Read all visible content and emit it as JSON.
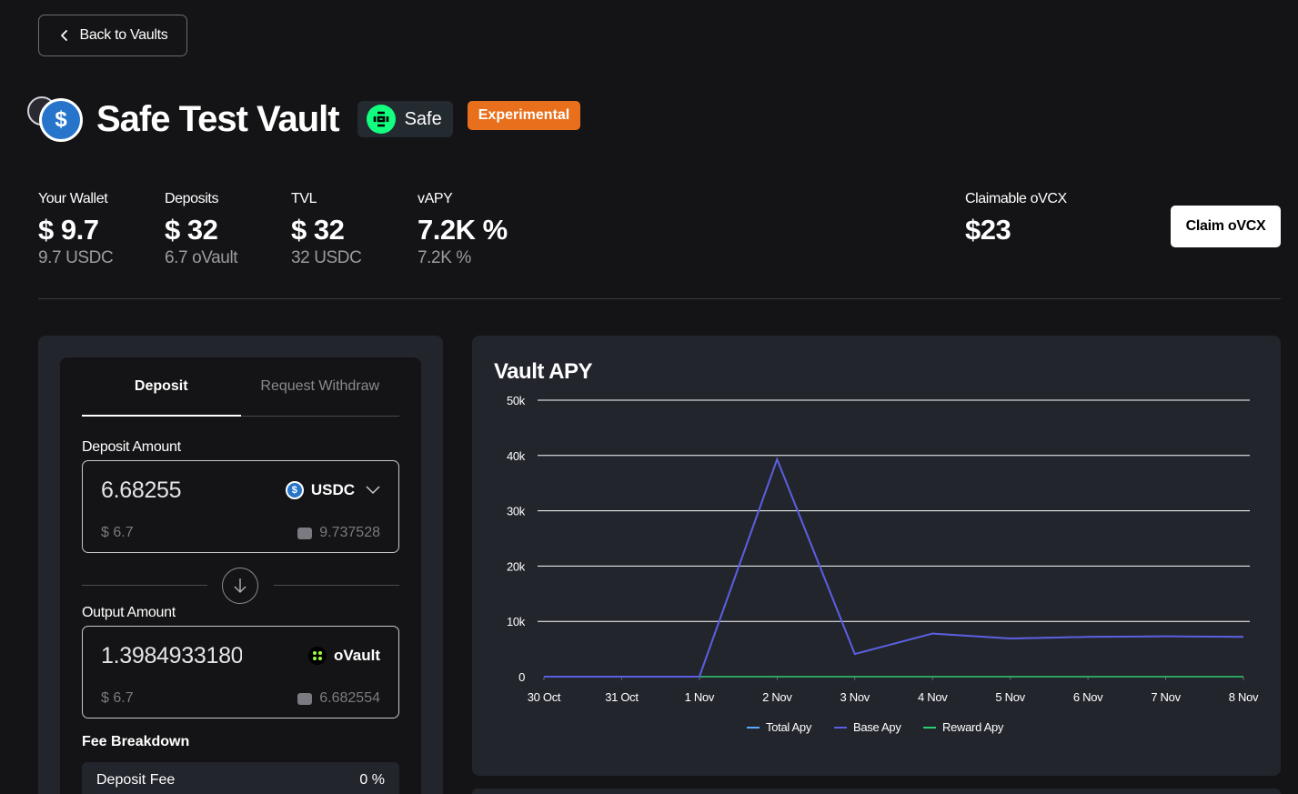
{
  "nav": {
    "back_label": "Back to Vaults"
  },
  "vault": {
    "title": "Safe Test Vault",
    "protocol": "Safe",
    "badge": "Experimental",
    "logo_symbol": "$"
  },
  "stats": [
    {
      "label": "Your Wallet",
      "value": "$ 9.7",
      "sub": "9.7 USDC"
    },
    {
      "label": "Deposits",
      "value": "$ 32",
      "sub": "6.7 oVault"
    },
    {
      "label": "TVL",
      "value": "$ 32",
      "sub": "32 USDC"
    },
    {
      "label": "vAPY",
      "value": "7.2K %",
      "sub": "7.2K %"
    }
  ],
  "claim": {
    "label": "Claimable oVCX",
    "value": "$23",
    "button": "Claim oVCX"
  },
  "form": {
    "tabs": [
      "Deposit",
      "Request Withdraw"
    ],
    "active_tab": "Deposit",
    "deposit": {
      "label": "Deposit Amount",
      "amount": "6.68255",
      "token": "USDC",
      "usd": "$ 6.7",
      "balance": "9.737528"
    },
    "output": {
      "label": "Output Amount",
      "amount": "1.39849331806",
      "token": "oVault",
      "usd": "$ 6.7",
      "balance": "6.682554"
    },
    "fee": {
      "label": "Fee Breakdown",
      "name": "Deposit Fee",
      "value": "0 %"
    }
  },
  "colors": {
    "background": "#141416",
    "panel": "#23252d",
    "accent_orange": "#e8701c",
    "safe_green": "#12ff80",
    "total_apy": "#5aa7ff",
    "base_apy": "#5a5ee0",
    "reward_apy": "#2ecc71"
  },
  "chart_data": {
    "type": "line",
    "title": "Vault APY",
    "categories": [
      "30 Oct",
      "31 Oct",
      "1 Nov",
      "2 Nov",
      "3 Nov",
      "4 Nov",
      "5 Nov",
      "6 Nov",
      "7 Nov",
      "8 Nov"
    ],
    "ylim": [
      0,
      50000
    ],
    "yticks": [
      0,
      10000,
      20000,
      30000,
      40000,
      50000
    ],
    "ytick_labels": [
      "0",
      "10k",
      "20k",
      "30k",
      "40k",
      "50k"
    ],
    "grid": true,
    "legend_position": "bottom",
    "series": [
      {
        "name": "Total Apy",
        "color": "#5aa7ff",
        "values": [
          0,
          0,
          0,
          39300,
          4100,
          7800,
          6900,
          7200,
          7300,
          7200
        ]
      },
      {
        "name": "Base Apy",
        "color": "#5a5ee0",
        "values": [
          0,
          0,
          0,
          39300,
          4100,
          7800,
          6900,
          7200,
          7300,
          7200
        ]
      },
      {
        "name": "Reward Apy",
        "color": "#2ecc71",
        "values": [
          0,
          0,
          0,
          0,
          0,
          0,
          0,
          0,
          0,
          0
        ]
      }
    ]
  }
}
